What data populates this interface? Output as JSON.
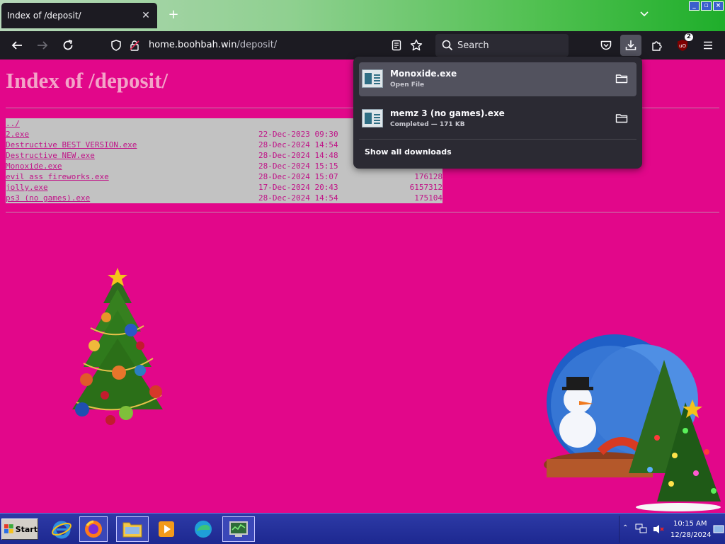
{
  "browser": {
    "tab_title": "Index of /deposit/",
    "tab_close_glyph": "✕",
    "new_tab_glyph": "+",
    "url_host": "home.boohbah.win",
    "url_path": "/deposit/",
    "search_placeholder": "Search",
    "extensions_badge": "2"
  },
  "page": {
    "heading": "Index of /deposit/",
    "listing": [
      {
        "name": "../",
        "date": "",
        "size": ""
      },
      {
        "name": "2.exe",
        "date": "22-Dec-2023 09:30",
        "size": ""
      },
      {
        "name": "Destructive BEST VERSION.exe",
        "date": "28-Dec-2024 14:54",
        "size": ""
      },
      {
        "name": "Destructive NEW.exe",
        "date": "28-Dec-2024 14:48",
        "size": ""
      },
      {
        "name": "Monoxide.exe",
        "date": "28-Dec-2024 15:15",
        "size": ""
      },
      {
        "name": "evil ass fireworks.exe",
        "date": "28-Dec-2024 15:07",
        "size": "176128"
      },
      {
        "name": "jolly.exe",
        "date": "17-Dec-2024 20:43",
        "size": "6157312"
      },
      {
        "name": "ps3 (no games).exe",
        "date": "28-Dec-2024 14:54",
        "size": "175104"
      }
    ]
  },
  "downloads_panel": {
    "items": [
      {
        "name": "Monoxide.exe",
        "status": "Open File"
      },
      {
        "name": "memz 3 (no games).exe",
        "status": "Completed — 171 KB"
      }
    ],
    "show_all_label": "Show all downloads"
  },
  "taskbar": {
    "start_label": "Start",
    "clock_time": "10:15 AM",
    "clock_date": "12/28/2024"
  },
  "colors": {
    "page_bg": "#e2078a",
    "link": "#c01488",
    "heading": "#f3a4c8",
    "listing_bg": "#c2c2c2"
  },
  "icons": [
    "back-icon",
    "forward-icon",
    "reload-icon",
    "shield-icon",
    "lock-icon",
    "reader-view-icon",
    "bookmark-star-icon",
    "search-icon",
    "pocket-icon",
    "download-icon",
    "extensions-icon",
    "ublock-icon",
    "menu-icon",
    "folder-icon",
    "file-exe-icon",
    "chevron-down-icon"
  ]
}
